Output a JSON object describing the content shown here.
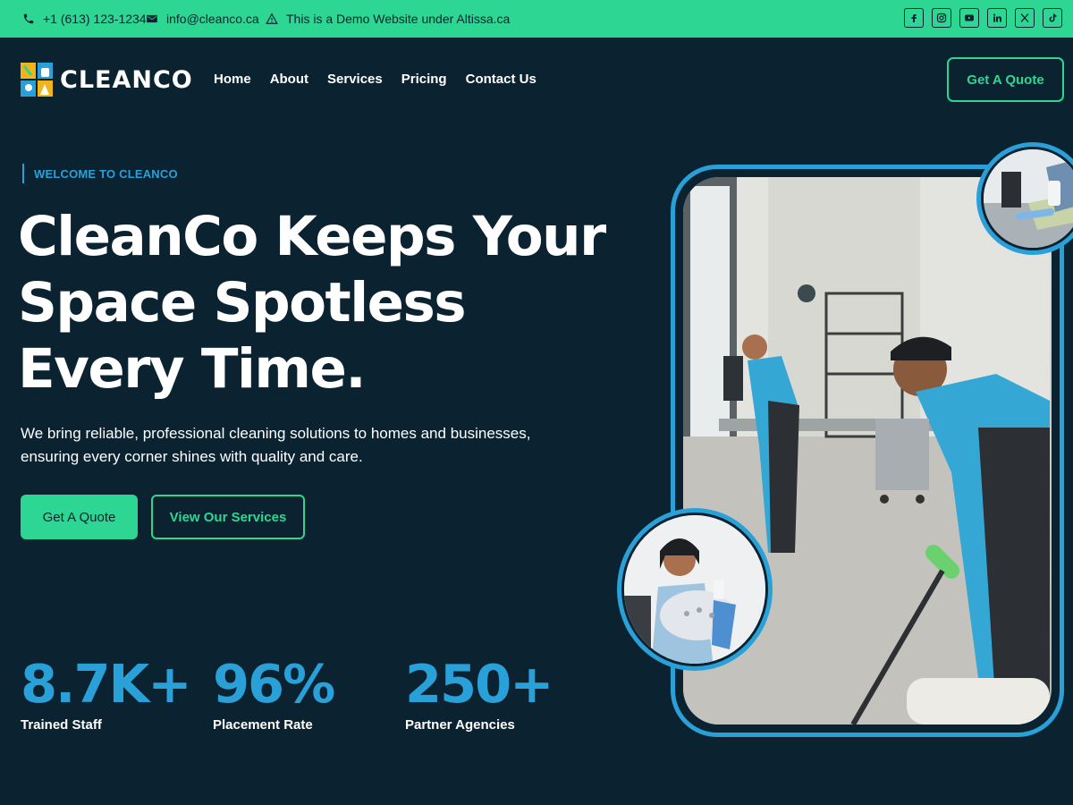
{
  "topbar": {
    "phone": "+1 (613) 123-1234",
    "email": "info@cleanco.ca",
    "notice": "This is a Demo Website under Altissa.ca",
    "socials": [
      "facebook-icon",
      "instagram-icon",
      "youtube-icon",
      "linkedin-icon",
      "x-icon",
      "tiktok-icon"
    ]
  },
  "header": {
    "logo_text": "CLEANCO",
    "nav": [
      "Home",
      "About",
      "Services",
      "Pricing",
      "Contact Us"
    ],
    "cta": "Get A Quote"
  },
  "hero": {
    "eyebrow": "WELCOME TO CLEANCO",
    "headline_lines": [
      "CleanCo Keeps Your",
      "Space Spotless",
      "Every Time."
    ],
    "subtext_lines": [
      "We bring reliable, professional cleaning solutions to homes and businesses,",
      "ensuring every corner shines with quality and care."
    ],
    "primary_button": "Get A Quote",
    "secondary_button": "View Our Services"
  },
  "stats": [
    {
      "value": "8.7K+",
      "label": "Trained Staff"
    },
    {
      "value": "96%",
      "label": "Placement Rate"
    },
    {
      "value": "250+",
      "label": "Partner Agencies"
    }
  ],
  "colors": {
    "background": "#0b2330",
    "accent_green": "#2ed693",
    "accent_blue": "#2aa0d8"
  }
}
